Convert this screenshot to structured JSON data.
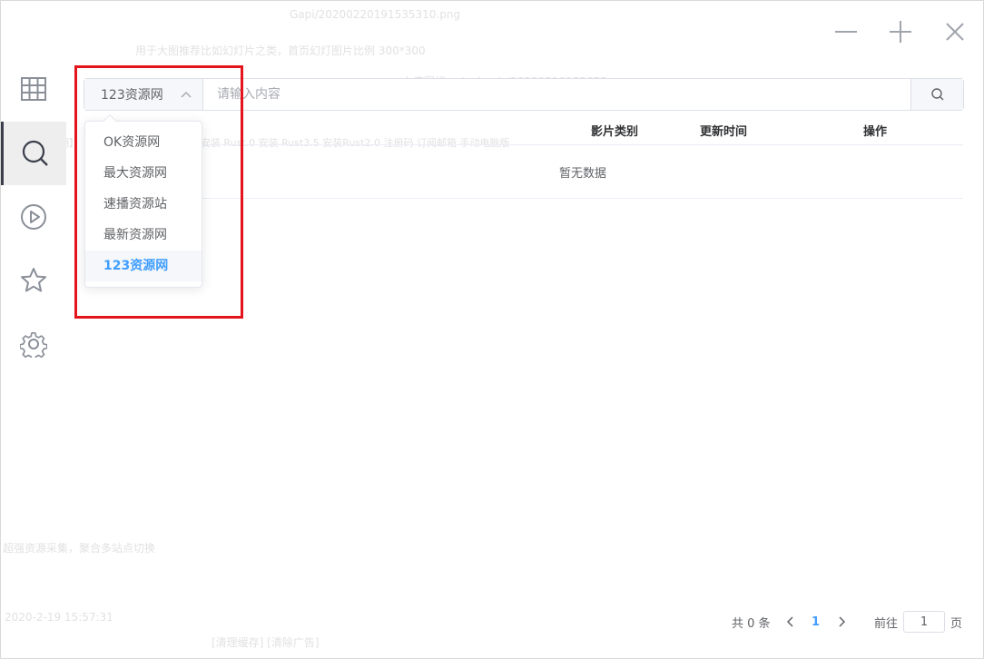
{
  "window": {
    "controls": {
      "minimize": "minimize",
      "maximize": "maximize",
      "close": "close"
    }
  },
  "sidebar": {
    "items": [
      {
        "icon": "grid-icon",
        "name": "sidebar-item-catalog"
      },
      {
        "icon": "search-icon",
        "name": "sidebar-item-search",
        "active": true
      },
      {
        "icon": "play-icon",
        "name": "sidebar-item-play"
      },
      {
        "icon": "star-icon",
        "name": "sidebar-item-favorites"
      },
      {
        "icon": "gear-icon",
        "name": "sidebar-item-settings"
      }
    ]
  },
  "search": {
    "source_selected": "123资源网",
    "placeholder": "请输入内容",
    "value": ""
  },
  "dropdown": {
    "options": [
      "OK资源网",
      "最大资源网",
      "速播资源站",
      "最新资源网",
      "123资源网"
    ],
    "selected": "123资源网"
  },
  "table": {
    "headers": {
      "category": "影片类别",
      "updated": "更新时间",
      "actions": "操作"
    },
    "empty_text": "暂无数据"
  },
  "pagination": {
    "total_label": "共 0 条",
    "current_page": "1",
    "goto_label": "前往",
    "goto_value": "1",
    "page_suffix": "页"
  },
  "background_ghost": {
    "line1": "Gapi/20200220191535310.png",
    "line2": "用于大图推荐比如幻灯片之类，首页幻灯图片比例 300*300",
    "line3": "上传图标：    /uploads/20200219153653.png",
    "line4": "【使用说明】 【更新日志】 安装V2006 安装 Rust.0 安装 Rust3.5 安装Rust2.0 注册码 订阅邮箱 手动电脑版",
    "line5": "超强资源采集，聚合多站点切换",
    "line6": "2020-2-19 15:57:31",
    "line7": "[清理缓存]  [清除广告]",
    "colors": {
      "accent": "#409eff",
      "highlight": "#e4141d"
    }
  }
}
